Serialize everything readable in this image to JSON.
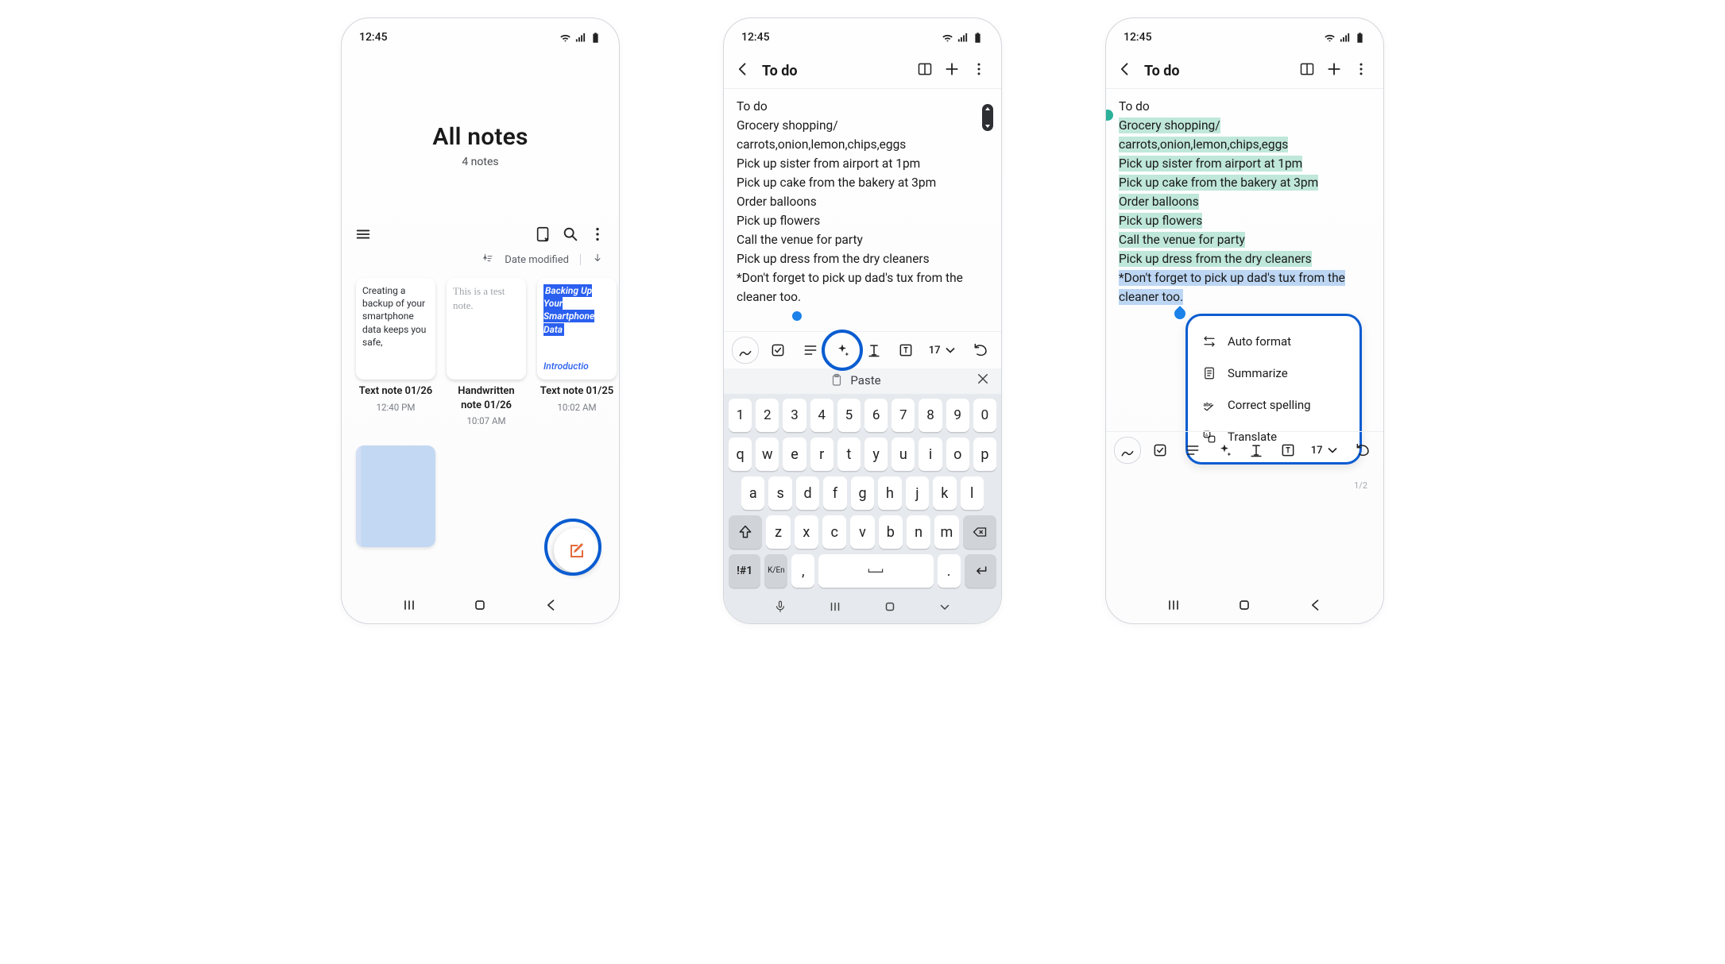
{
  "statusbar": {
    "time": "12:45"
  },
  "screen1": {
    "title": "All notes",
    "subtitle": "4 notes",
    "sort_label": "Date modified",
    "cards": [
      {
        "preview": "Creating a backup of your smartphone data keeps you safe,",
        "title": "Text note 01/26",
        "time": "12:40 PM"
      },
      {
        "preview": "This is a test note.",
        "title": "Handwritten note 01/26",
        "time": "10:07 AM"
      },
      {
        "preview_block": "Backing Up Your Smartphone Data",
        "preview_intro": "Introductio",
        "title": "Text note 01/25",
        "time": "10:02 AM"
      }
    ]
  },
  "screen2": {
    "header_title": "To do",
    "note_lines": [
      "To do",
      "Grocery shopping/",
      "carrots,onion,lemon,chips,eggs",
      "Pick up sister from airport at 1pm",
      "Pick up cake from the bakery at 3pm",
      "Order balloons",
      "Pick up flowers",
      "Call the venue for party",
      "Pick up dress from the dry cleaners",
      "*Don't forget to pick up dad's tux from the cleaner too."
    ],
    "font_size": "17",
    "paste_label": "Paste",
    "keyboard": {
      "row_num": [
        "1",
        "2",
        "3",
        "4",
        "5",
        "6",
        "7",
        "8",
        "9",
        "0"
      ],
      "row1": [
        "q",
        "w",
        "e",
        "r",
        "t",
        "y",
        "u",
        "i",
        "o",
        "p"
      ],
      "row2": [
        "a",
        "s",
        "d",
        "f",
        "g",
        "h",
        "j",
        "k",
        "l"
      ],
      "row3": [
        "z",
        "x",
        "c",
        "v",
        "b",
        "n",
        "m"
      ],
      "sym": "!#1",
      "lang": "K/En",
      "comma": ",",
      "period": "."
    }
  },
  "screen3": {
    "header_title": "To do",
    "note_lines": [
      "To do",
      "Grocery shopping/",
      "carrots,onion,lemon,chips,eggs",
      "Pick up sister from airport at 1pm",
      "Pick up cake from the bakery at 3pm",
      "Order balloons",
      "Pick up flowers",
      "Call the venue for party",
      "Pick up dress from the dry cleaners",
      "*Don't forget to pick up dad's tux from the cleaner too."
    ],
    "font_size": "17",
    "ai_menu": {
      "auto_format": "Auto format",
      "summarize": "Summarize",
      "correct": "Correct spelling",
      "translate": "Translate"
    },
    "page_indicator": "1/2"
  }
}
